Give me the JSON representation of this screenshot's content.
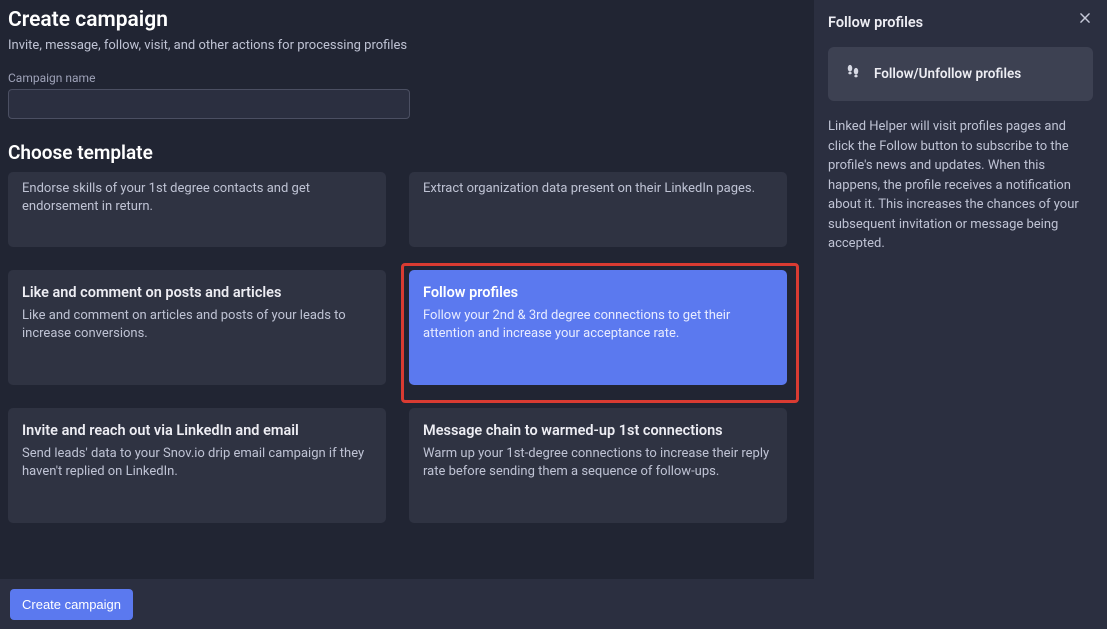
{
  "header": {
    "title": "Create campaign",
    "subtitle": "Invite, message, follow, visit, and other actions for processing profiles"
  },
  "campaignName": {
    "label": "Campaign name",
    "value": ""
  },
  "sectionTitle": "Choose template",
  "templates": {
    "partial1": {
      "desc": "Endorse skills of your 1st degree contacts and get endorsement in return."
    },
    "partial2": {
      "desc": "Extract organization data present on their LinkedIn pages."
    },
    "card1": {
      "title": "Like and comment on posts and articles",
      "desc": "Like and comment on articles and posts of your leads to increase conversions."
    },
    "card2": {
      "title": "Follow profiles",
      "desc": "Follow your 2nd & 3rd degree connections to get their attention and increase your acceptance rate."
    },
    "card3": {
      "title": "Invite and reach out via LinkedIn and email",
      "desc": "Send leads' data to your Snov.io drip email campaign if they haven't replied on LinkedIn."
    },
    "card4": {
      "title": "Message chain to warmed-up 1st connections",
      "desc": "Warm up your 1st-degree connections to increase their reply rate before sending them a sequence of follow-ups."
    }
  },
  "footer": {
    "createLabel": "Create campaign"
  },
  "sidebar": {
    "title": "Follow profiles",
    "pillLabel": "Follow/Unfollow profiles",
    "description": "Linked Helper will visit profiles pages and click the Follow button to subscribe to the profile's news and updates. When this happens, the profile receives a notification about it. This increases the chances of your subsequent invitation or message being accepted."
  }
}
